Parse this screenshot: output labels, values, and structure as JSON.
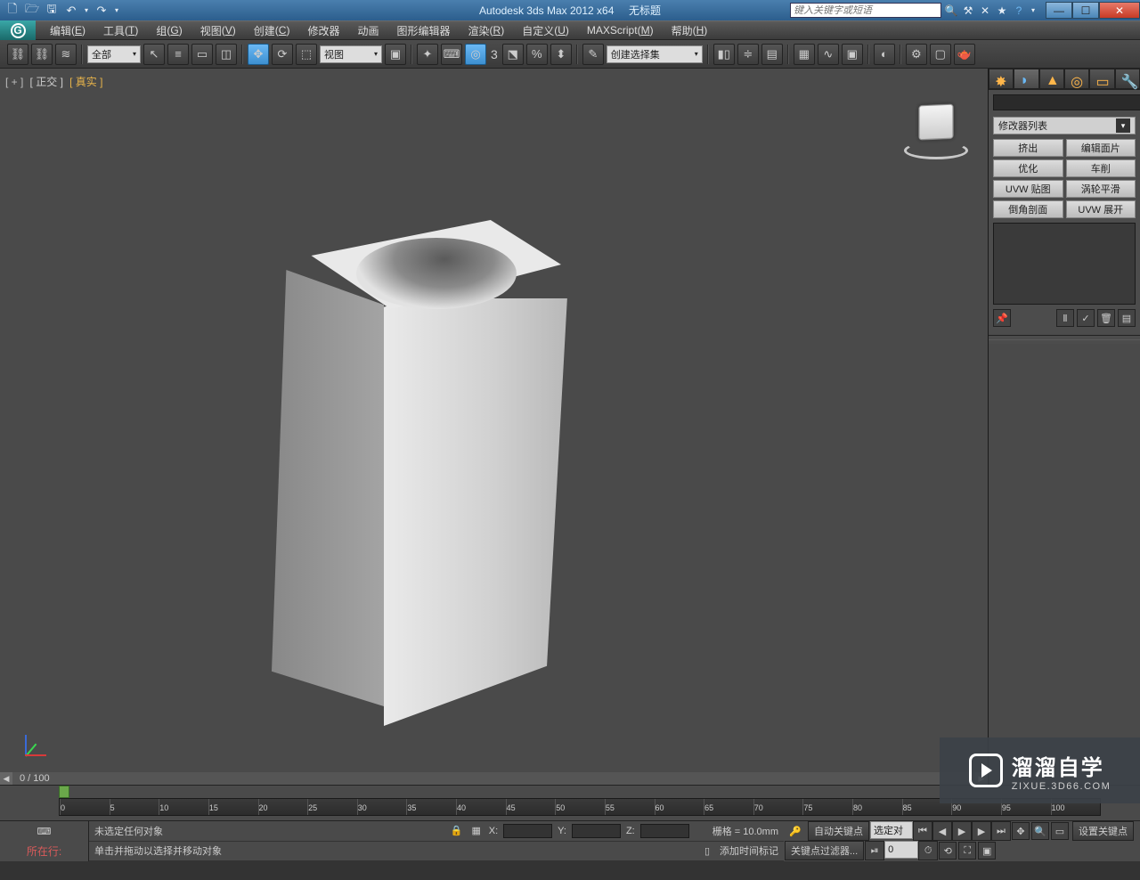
{
  "title": {
    "app": "Autodesk 3ds Max  2012 x64",
    "doc": "无标题"
  },
  "search": {
    "placeholder": "键入关键字或短语"
  },
  "menus": [
    {
      "label": "编辑",
      "key": "E"
    },
    {
      "label": "工具",
      "key": "T"
    },
    {
      "label": "组",
      "key": "G"
    },
    {
      "label": "视图",
      "key": "V"
    },
    {
      "label": "创建",
      "key": "C"
    },
    {
      "label": "修改器",
      "key": ""
    },
    {
      "label": "动画",
      "key": ""
    },
    {
      "label": "图形编辑器",
      "key": ""
    },
    {
      "label": "渲染",
      "key": "R"
    },
    {
      "label": "自定义",
      "key": "U"
    },
    {
      "label": "MAXScript",
      "key": "M"
    },
    {
      "label": "帮助",
      "key": "H"
    }
  ],
  "toolbar": {
    "filter_all": "全部",
    "view_dropdown": "视图",
    "named_selection": "创建选择集",
    "snap_number": "3"
  },
  "viewport": {
    "label_plus": "[ + ]",
    "label_viewname": "正交",
    "label_shading": "真实",
    "frame_display": "0 / 100"
  },
  "timeline": {
    "ticks": [
      "0",
      "5",
      "10",
      "15",
      "20",
      "25",
      "30",
      "35",
      "40",
      "45",
      "50",
      "55",
      "60",
      "65",
      "70",
      "75",
      "80",
      "85",
      "90",
      "95",
      "100"
    ]
  },
  "command_panel": {
    "modifier_list": "修改器列表",
    "buttons": [
      "挤出",
      "编辑面片",
      "优化",
      "车削",
      "UVW 贴图",
      "涡轮平滑",
      "倒角剖面",
      "UVW 展开"
    ]
  },
  "status": {
    "location_label": "所在行:",
    "sel_msg": "未选定任何对象",
    "hint_msg": "单击并拖动以选择并移动对象",
    "grid_label": "栅格 = 10.0mm",
    "add_time_tag": "添加时间标记",
    "autokey": "自动关键点",
    "selected": "选定对",
    "setkey": "设置关键点",
    "keyfilter": "关键点过滤器...",
    "coords": {
      "x": "X:",
      "y": "Y:",
      "z": "Z:"
    },
    "frame_field": "0"
  },
  "watermark": {
    "cn": "溜溜自学",
    "en": "ZIXUE.3D66.COM"
  }
}
